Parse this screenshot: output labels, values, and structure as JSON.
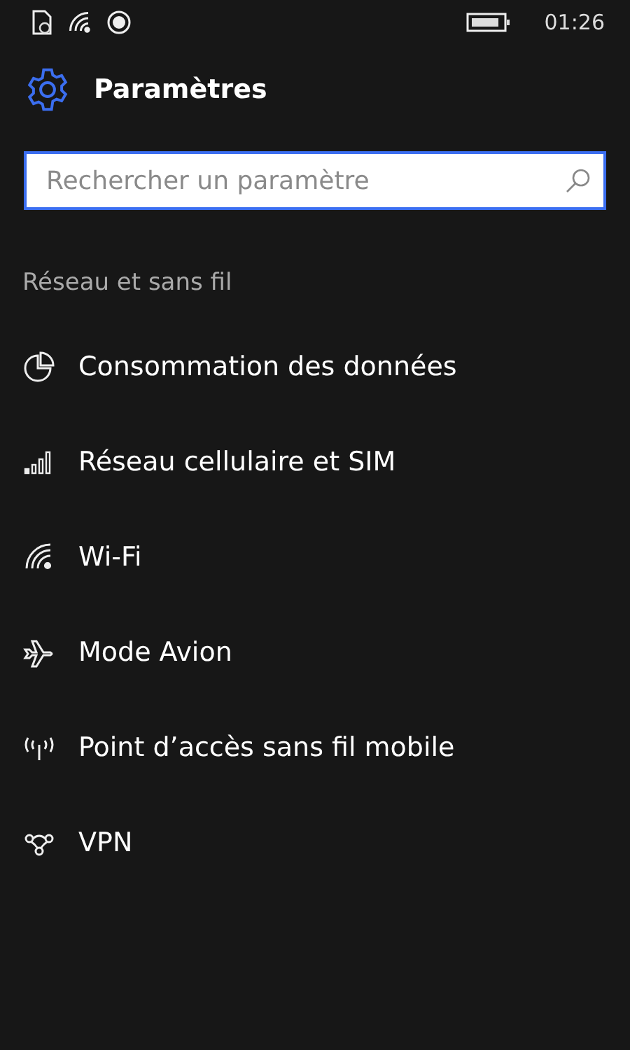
{
  "status_bar": {
    "time": "01:26"
  },
  "header": {
    "title": "Paramètres"
  },
  "search": {
    "placeholder": "Rechercher un paramètre"
  },
  "section": {
    "title": "Réseau et sans fil"
  },
  "items": [
    {
      "kind": "data",
      "label": "Consommation des données"
    },
    {
      "kind": "cellular",
      "label": "Réseau cellulaire et SIM"
    },
    {
      "kind": "wifi",
      "label": "Wi-Fi"
    },
    {
      "kind": "airplane",
      "label": "Mode Avion"
    },
    {
      "kind": "hotspot",
      "label": "Point d’accès sans fil mobile"
    },
    {
      "kind": "vpn",
      "label": "VPN"
    }
  ]
}
